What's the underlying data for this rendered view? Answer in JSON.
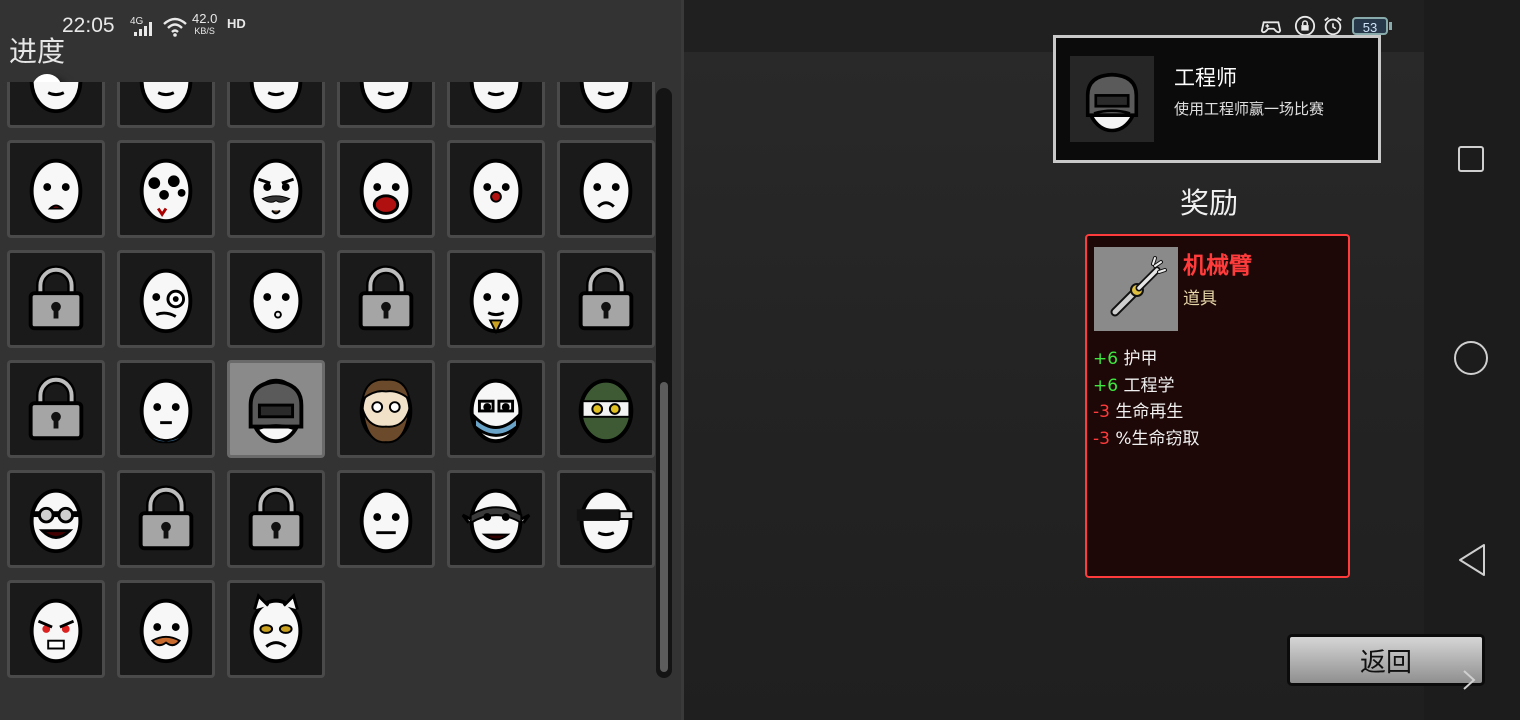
{
  "status_bar": {
    "time": "22:05",
    "network_type": "4G",
    "speed_value": "42.0",
    "speed_unit": "KB/S",
    "hd": "HD",
    "icons": [
      "signal-icon",
      "wifi-icon",
      "controller-icon",
      "lock-rotation-icon",
      "alarm-icon"
    ],
    "battery_level": "53"
  },
  "left_panel": {
    "title": "进度",
    "grid": [
      "face-partial",
      "face-partial",
      "face-partial",
      "face-partial",
      "face-partial",
      "face-partial",
      "face-sick",
      "face-many-eyes",
      "face-mustache",
      "face-scream",
      "face-red-nose",
      "face-sad",
      "lock",
      "face-big-eye",
      "face-whistle",
      "lock",
      "face-goatee",
      "lock",
      "lock",
      "face-scarf",
      "face-helmet",
      "face-bearded",
      "face-glasses-mask",
      "face-ninja",
      "face-goggles",
      "lock",
      "lock",
      "face-blank",
      "face-spiked",
      "face-visor",
      "face-angry",
      "face-ginger-mustache",
      "face-cat"
    ],
    "selected_index": 20
  },
  "achievement": {
    "title": "工程师",
    "description": "使用工程师赢一场比赛",
    "icon": "helmet-face-icon"
  },
  "reward": {
    "label": "奖励",
    "item_name": "机械臂",
    "item_type": "道具",
    "item_icon": "robotic-arm-icon",
    "stats": [
      {
        "value": "+6",
        "label": "护甲",
        "positive": true
      },
      {
        "value": "+6",
        "label": "工程学",
        "positive": true
      },
      {
        "value": "-3",
        "label": "生命再生",
        "positive": false
      },
      {
        "value": "-3",
        "label": "%生命窃取",
        "positive": false
      }
    ]
  },
  "back_button": "返回",
  "nav": [
    "recent-apps-icon",
    "home-icon",
    "back-icon",
    "chevron-right-icon"
  ]
}
